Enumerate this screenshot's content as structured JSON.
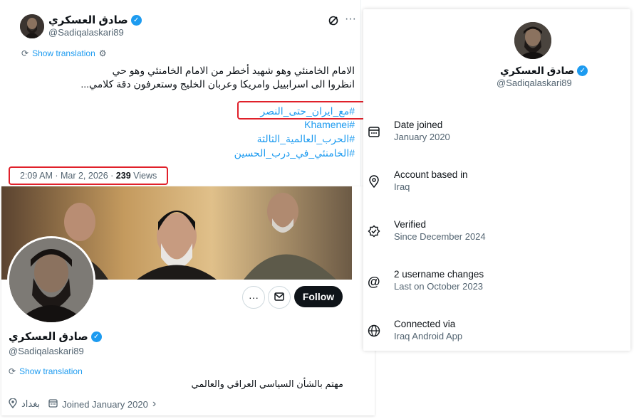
{
  "tweet": {
    "author_name": "صادق العسكري",
    "author_handle": "@Sadiqalaskari89",
    "more_label": "···",
    "show_translation": "Show translation",
    "text_line1": "الامام الخامنئي وهو شهيد أخطر من الامام الخامنئي وهو حي",
    "text_line2": "انظروا الى اسرابييل وامريكا وعربان الخليج وستعرفون دقة كلامي...",
    "hashtags": [
      "#مع_ايران_حتى_النصر",
      "#Khamenei",
      "#الحرب_العالمية_الثالثة",
      "#الخامنئي_في_درب_الحسين"
    ],
    "timestamp": "2:09 AM · Mar 2, 2026 · ",
    "views_count": "239",
    "views_label": " Views"
  },
  "profile": {
    "name": "صادق العسكري",
    "handle": "@Sadiqalaskari89",
    "follow_label": "Follow",
    "show_translation": "Show translation",
    "bio": "مهتم بالشأن السياسي العراقي والعالمي",
    "location": "بغداد",
    "joined": "Joined January 2020",
    "chevron": "›"
  },
  "about": {
    "name": "صادق العسكري",
    "handle": "@Sadiqalaskari89",
    "rows": [
      {
        "icon": "calendar-icon",
        "title": "Date joined",
        "sub": "January 2020"
      },
      {
        "icon": "location-pin-icon",
        "title": "Account based in",
        "sub": "Iraq"
      },
      {
        "icon": "verified-badge-icon",
        "title": "Verified",
        "sub": "Since December 2024"
      },
      {
        "icon": "at-sign-icon",
        "title": "2 username changes",
        "sub": "Last on October 2023"
      },
      {
        "icon": "globe-icon",
        "title": "Connected via",
        "sub": "Iraq Android App"
      }
    ]
  },
  "colors": {
    "accent": "#1d9bf0",
    "highlight_box": "#e0202a",
    "text": "#0f1419",
    "muted": "#536471"
  }
}
